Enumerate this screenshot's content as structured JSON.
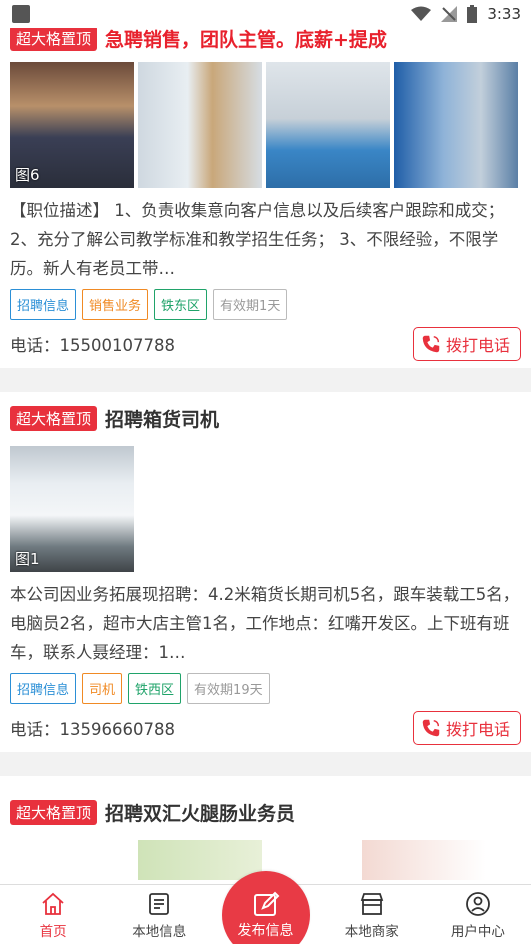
{
  "status_bar": {
    "time": "3:33"
  },
  "listings": [
    {
      "badge": "超大格置顶",
      "title": "急聘销售，团队主管。底薪+提成",
      "image_count_label": "图6",
      "description": "【职位描述】 1、负责收集意向客户信息以及后续客户跟踪和成交； 2、充分了解公司教学标准和教学招生任务； 3、不限经验，不限学历。新人有老员工带…",
      "tags": [
        "招聘信息",
        "销售业务",
        "铁东区",
        "有效期1天"
      ],
      "phone": "电话：15500107788",
      "call_label": "拨打电话"
    },
    {
      "badge": "超大格置顶",
      "title": "招聘箱货司机",
      "image_count_label": "图1",
      "description": "本公司因业务拓展现招聘：4.2米箱货长期司机5名，跟车装载工5名，电脑员2名，超市大店主管1名，工作地点：红嘴开发区。上下班有班车，联系人聂经理：1…",
      "tags": [
        "招聘信息",
        "司机",
        "铁西区",
        "有效期19天"
      ],
      "phone": "电话：13596660788",
      "call_label": "拨打电话"
    },
    {
      "badge": "超大格置顶",
      "title": "招聘双汇火腿肠业务员"
    }
  ],
  "tabbar": {
    "home": "首页",
    "local_info": "本地信息",
    "publish": "发布信息",
    "local_merchants": "本地商家",
    "user_center": "用户中心"
  },
  "colors": {
    "accent": "#e8313d",
    "tag_blue": "#2b8fd6",
    "tag_orange": "#f08a24",
    "tag_green": "#20a36a"
  }
}
